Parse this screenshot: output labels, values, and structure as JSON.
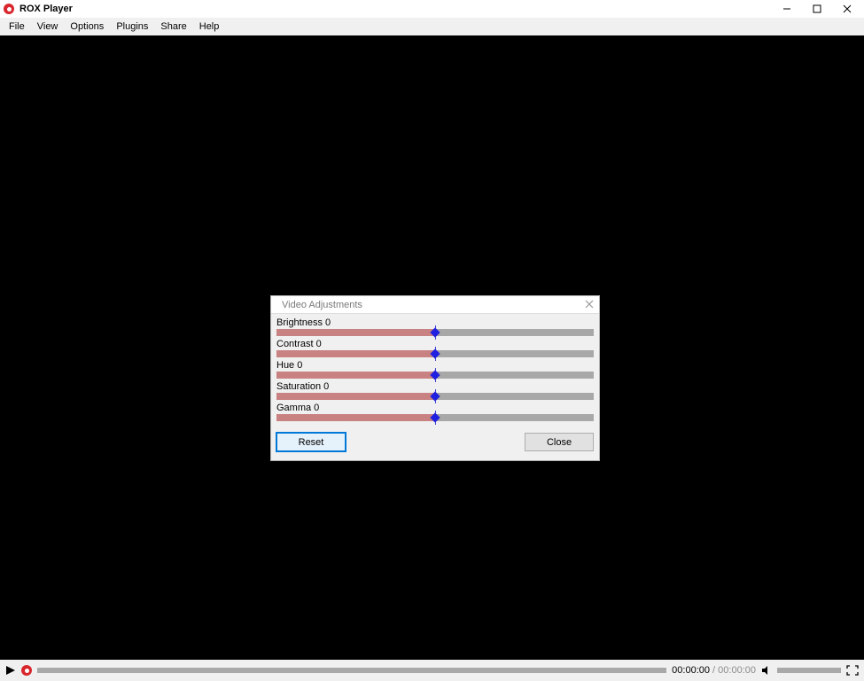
{
  "app": {
    "title": "ROX Player"
  },
  "menu": {
    "file": "File",
    "view": "View",
    "options": "Options",
    "plugins": "Plugins",
    "share": "Share",
    "help": "Help"
  },
  "playback": {
    "current_time": "00:00:00",
    "separator": " / ",
    "total_time": "00:00:00"
  },
  "dialog": {
    "title": "Video Adjustments",
    "sliders": {
      "brightness": {
        "label": "Brightness",
        "value": "0"
      },
      "contrast": {
        "label": "Contrast",
        "value": "0"
      },
      "hue": {
        "label": "Hue",
        "value": "0"
      },
      "saturation": {
        "label": "Saturation",
        "value": "0"
      },
      "gamma": {
        "label": "Gamma",
        "value": "0"
      }
    },
    "reset_label": "Reset",
    "close_label": "Close"
  }
}
